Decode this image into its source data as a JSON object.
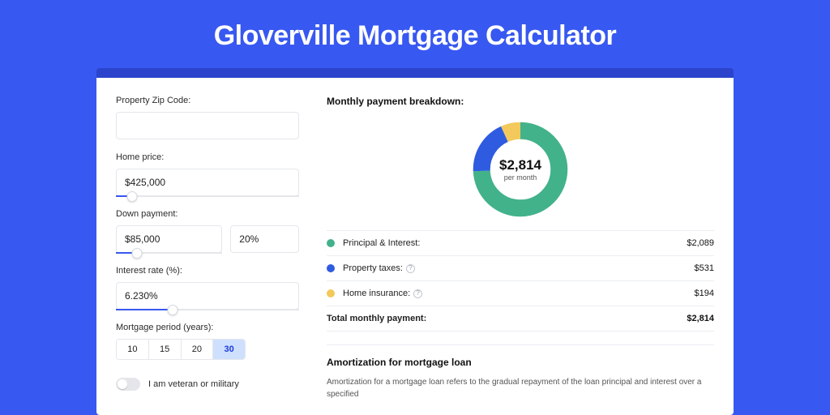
{
  "title": "Gloverville Mortgage Calculator",
  "left": {
    "zip": {
      "label": "Property Zip Code:",
      "value": ""
    },
    "home_price": {
      "label": "Home price:",
      "value": "$425,000",
      "slider_pct": 9
    },
    "down_payment": {
      "label": "Down payment:",
      "amount": "$85,000",
      "percent": "20%",
      "slider_pct": 20
    },
    "interest_rate": {
      "label": "Interest rate (%):",
      "value": "6.230%",
      "slider_pct": 31
    },
    "period": {
      "label": "Mortgage period (years):",
      "options": [
        "10",
        "15",
        "20",
        "30"
      ],
      "active_index": 3
    },
    "veteran": {
      "label": "I am veteran or military",
      "on": false
    }
  },
  "right": {
    "breakdown_title": "Monthly payment breakdown:",
    "donut": {
      "amount": "$2,814",
      "sub": "per month"
    },
    "legend": {
      "pi": {
        "label": "Principal & Interest:",
        "value": "$2,089"
      },
      "pt": {
        "label": "Property taxes:",
        "value": "$531"
      },
      "hi": {
        "label": "Home insurance:",
        "value": "$194"
      },
      "total": {
        "label": "Total monthly payment:",
        "value": "$2,814"
      }
    },
    "amort": {
      "title": "Amortization for mortgage loan",
      "body": "Amortization for a mortgage loan refers to the gradual repayment of the loan principal and interest over a specified"
    }
  },
  "colors": {
    "pi": "#42b28a",
    "pt": "#2f5be0",
    "hi": "#f3c95b"
  },
  "chart_data": {
    "type": "pie",
    "title": "Monthly payment breakdown",
    "categories": [
      "Principal & Interest",
      "Property taxes",
      "Home insurance"
    ],
    "values": [
      2089,
      531,
      194
    ],
    "total": 2814,
    "unit": "USD per month"
  }
}
